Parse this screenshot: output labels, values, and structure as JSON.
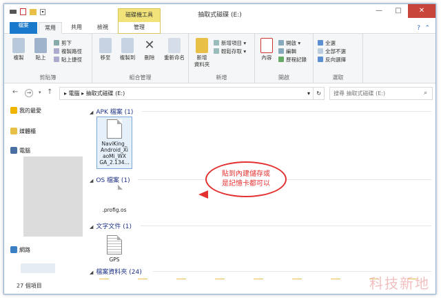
{
  "titlebar": {
    "context_tab": "磁碟機工具",
    "title": "抽取式磁碟 (E:)",
    "min": "—",
    "max": "□",
    "close": "✕"
  },
  "tabs": {
    "file": "檔案",
    "home": "常用",
    "share": "共用",
    "view": "檢視",
    "manage": "管理"
  },
  "ribbon": {
    "copy": "複製",
    "paste": "貼上",
    "cut": "剪下",
    "copy_path": "複製路徑",
    "paste_shortcut": "貼上捷徑",
    "move_to": "移至",
    "copy_to": "複製到",
    "delete": "刪除",
    "rename": "重新命名",
    "new_folder": "新增\n資料夾",
    "new_item": "新增項目 ▾",
    "easy_access": "輕鬆存取 ▾",
    "properties": "內容",
    "open": "開啟 ▾",
    "edit": "編輯",
    "history": "歷程記錄",
    "select_all": "全選",
    "select_none": "全部不選",
    "invert": "反向選擇",
    "groups": {
      "clipboard": "剪貼簿",
      "organize": "組合管理",
      "new": "新增",
      "open": "開啟",
      "select": "選取"
    }
  },
  "address": {
    "path": "▸  電腦  ▸  抽取式磁碟 (E:)",
    "search_placeholder": "搜尋 抽取式磁碟 (E:)"
  },
  "sidebar": {
    "favorites": "我的最愛",
    "libraries": "媒體櫃",
    "computer": "電腦",
    "network": "網路"
  },
  "groups": [
    {
      "label": "APK 檔案 (1)"
    },
    {
      "label": "OS 檔案 (1)"
    },
    {
      "label": "文字文件 (1)"
    },
    {
      "label": "檔案資料夾 (24)"
    }
  ],
  "files": {
    "apk": "NaviKing_\nAndroid_Xi\naoMi_WX\nGA_2.134...",
    "os": ".profig.os",
    "txt": "GPS"
  },
  "annotation": "貼到內建儲存或\n是記憶卡都可以",
  "status": "27 個項目",
  "watermark": "科技新地",
  "colors": {
    "accent": "#1979ca",
    "context": "#f1e37a",
    "callout": "#e53030"
  }
}
